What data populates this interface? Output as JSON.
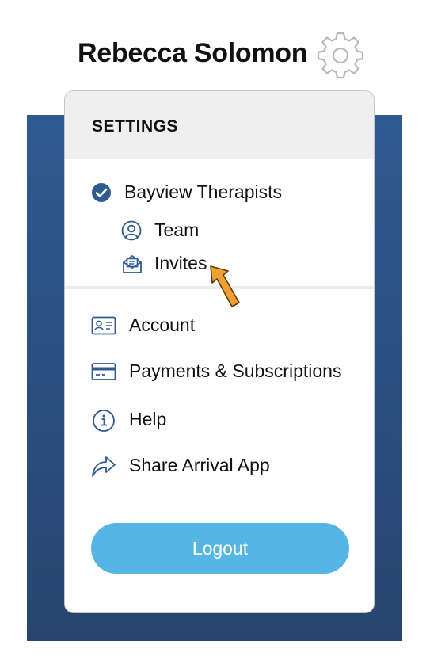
{
  "header": {
    "user_name": "Rebecca Solomon",
    "settings_icon": "gear-icon"
  },
  "menu": {
    "title": "SETTINGS",
    "organization": {
      "name": "Bayview Therapists",
      "selected": true,
      "icon": "check-circle-icon"
    },
    "org_items": [
      {
        "label": "Team",
        "icon": "user-circle-icon"
      },
      {
        "label": "Invites",
        "icon": "envelope-open-icon"
      }
    ],
    "items": [
      {
        "label": "Account",
        "icon": "id-card-icon"
      },
      {
        "label": "Payments & Subscriptions",
        "icon": "credit-card-icon"
      },
      {
        "label": "Help",
        "icon": "info-icon"
      },
      {
        "label": "Share Arrival App",
        "icon": "share-arrow-icon"
      }
    ],
    "logout_label": "Logout"
  },
  "colors": {
    "accent": "#2f5a92",
    "logout_button": "#55b6e6",
    "pointer_arrow": "#f0a030"
  }
}
